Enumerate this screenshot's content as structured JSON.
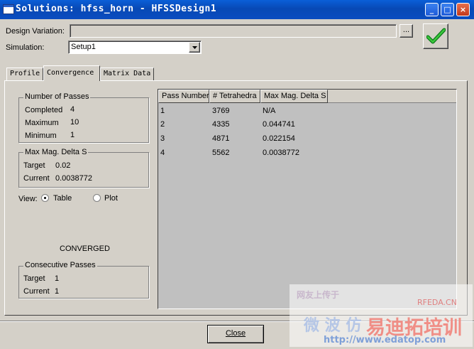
{
  "window": {
    "title": "Solutions: hfss_horn - HFSSDesign1",
    "buttons": {
      "minimize": "_",
      "maximize": "□",
      "close": "×"
    }
  },
  "design_variation": {
    "label": "Design Variation:",
    "value": "",
    "browse": "..."
  },
  "simulation": {
    "label": "Simulation:",
    "value": "Setup1"
  },
  "status_icon": "check-icon",
  "tabs": [
    {
      "label": "Profile"
    },
    {
      "label": "Convergence"
    },
    {
      "label": "Matrix Data"
    }
  ],
  "number_of_passes": {
    "title": "Number of Passes",
    "completed_label": "Completed",
    "completed": "4",
    "maximum_label": "Maximum",
    "maximum": "10",
    "minimum_label": "Minimum",
    "minimum": "1"
  },
  "max_mag_delta": {
    "title": "Max Mag. Delta S",
    "target_label": "Target",
    "target": "0.02",
    "current_label": "Current",
    "current": "0.0038772"
  },
  "view": {
    "label": "View:",
    "table": "Table",
    "plot": "Plot",
    "selected": "Table"
  },
  "status": "CONVERGED",
  "consecutive_passes": {
    "title": "Consecutive Passes",
    "target_label": "Target",
    "target": "1",
    "current_label": "Current",
    "current": "1"
  },
  "table": {
    "columns": [
      "Pass Number",
      "# Tetrahedra",
      "Max Mag. Delta S"
    ],
    "rows": [
      [
        "1",
        "3769",
        "N/A"
      ],
      [
        "2",
        "4335",
        "0.044741"
      ],
      [
        "3",
        "4871",
        "0.022154"
      ],
      [
        "4",
        "5562",
        "0.0038772"
      ]
    ]
  },
  "close_button": "Close",
  "watermark": {
    "line1": "网友上传于",
    "rfeda": "RFEDA.CN",
    "wei": "微 波 仿",
    "brand": "易迪拓培训",
    "url": "http://www.edatop.com"
  }
}
